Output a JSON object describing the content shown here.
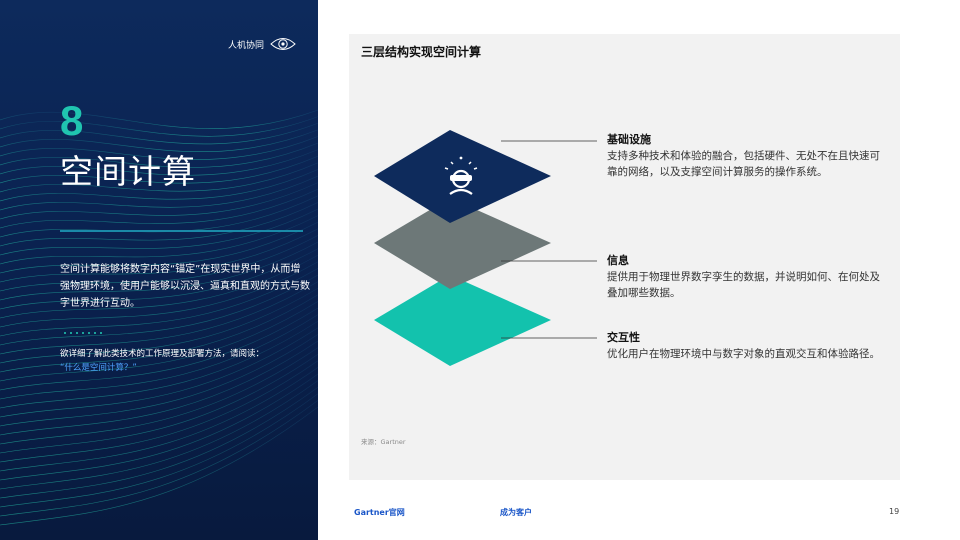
{
  "brand": {
    "label": "人机协同",
    "icon": "eye-icon"
  },
  "section": {
    "number": "8",
    "title": "空间计算",
    "description": "空间计算能够将数字内容“锚定”在现实世界中，从而增强物理环境，使用户能够以沉浸、逼真和直观的方式与数字世界进行互动。",
    "cta_text": "欲详细了解此类技术的工作原理及部署方法，请阅读：",
    "cta_link": "“什么是空间计算？”"
  },
  "card": {
    "title": "三层结构实现空间计算",
    "layers": [
      {
        "title": "基础设施",
        "text": "支持多种技术和体验的融合，包括硬件、无处不在且快速可靠的网络，以及支撑空间计算服务的操作系统。",
        "color": "#0e2b5c"
      },
      {
        "title": "信息",
        "text": "提供用于物理世界数字孪生的数据，并说明如何、在何处及叠加哪些数据。",
        "color": "#6d7878"
      },
      {
        "title": "交互性",
        "text": "优化用户在物理环境中与数字对象的直观交互和体验路径。",
        "color": "#13c2ad"
      }
    ],
    "source": "来源：Gartner"
  },
  "footer": {
    "gartner_link": "Gartner官网",
    "customer_link": "成为客户",
    "page_number": "19"
  }
}
